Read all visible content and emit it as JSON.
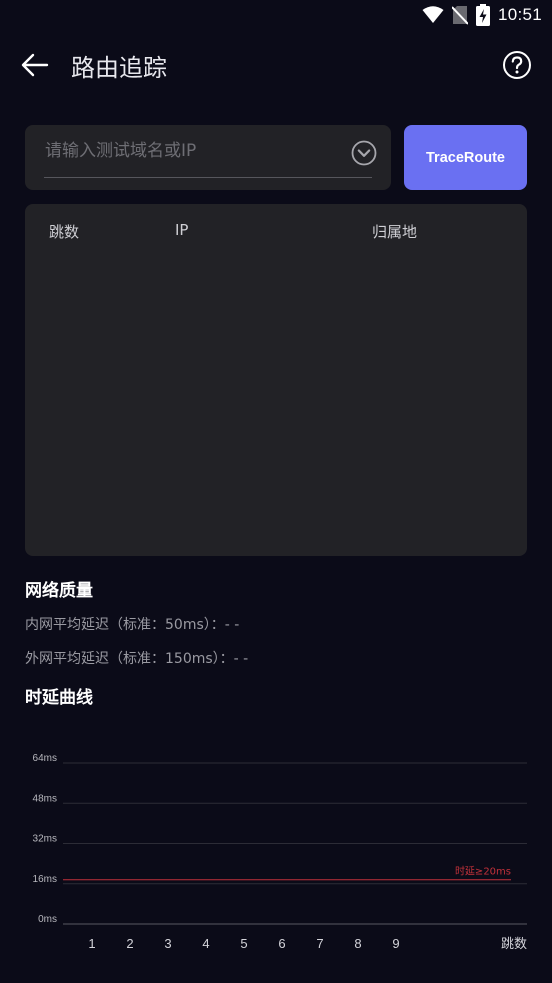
{
  "status_bar": {
    "time": "10:51",
    "icons": [
      "wifi-icon",
      "no-sim-icon",
      "battery-charging-icon"
    ]
  },
  "header": {
    "title": "路由追踪",
    "back_icon": "back-arrow-icon",
    "help_icon": "help-icon"
  },
  "input": {
    "placeholder": "请输入测试域名或IP",
    "value": "",
    "dropdown_icon": "chevron-down-circle-icon"
  },
  "trace_button": {
    "label": "TraceRoute"
  },
  "results": {
    "columns": [
      "跳数",
      "IP",
      "归属地"
    ],
    "rows": []
  },
  "network_quality": {
    "title": "网络质量",
    "intranet": "内网平均延迟（标准：50ms）：- -",
    "extranet": "外网平均延迟（标准：150ms）：- -"
  },
  "latency_chart": {
    "title": "时延曲线"
  },
  "colors": {
    "background": "#0b0b18",
    "panel": "#222226",
    "accent": "#6a70f2",
    "threshold": "#c0313a"
  },
  "chart_data": {
    "type": "line",
    "y_ticks": [
      "0ms",
      "16ms",
      "32ms",
      "48ms",
      "64ms"
    ],
    "ylim": [
      0,
      64
    ],
    "categories": [
      "1",
      "2",
      "3",
      "4",
      "5",
      "6",
      "7",
      "8",
      "9"
    ],
    "xlabel": "跳数",
    "series": [],
    "threshold": {
      "label": "时延≥20ms",
      "value": 20
    },
    "grid": true
  }
}
